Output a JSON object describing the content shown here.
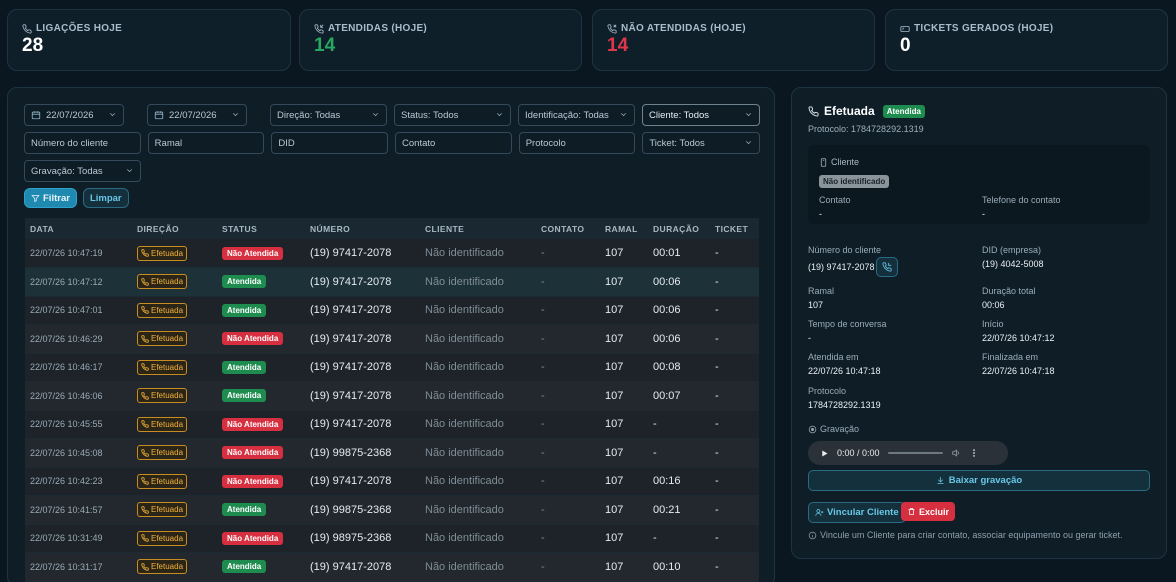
{
  "stats": [
    {
      "label": "LIGAÇÕES HOJE",
      "value": "28",
      "icon": "phone-icon"
    },
    {
      "label": "ATENDIDAS (HOJE)",
      "value": "14",
      "icon": "phone-incoming-icon"
    },
    {
      "label": "NÃO ATENDIDAS (HOJE)",
      "value": "14",
      "icon": "phone-missed-icon"
    },
    {
      "label": "TICKETS GERADOS (HOJE)",
      "value": "0",
      "icon": "ticket-icon"
    }
  ],
  "filters": {
    "date_from": "22/07/2026",
    "date_to": "22/07/2026",
    "direction": "Direção: Todas",
    "status": "Status: Todos",
    "identification": "Identificação: Todas",
    "client": "Cliente: Todos",
    "client_number_placeholder": "Número do cliente",
    "extension_placeholder": "Ramal",
    "did_placeholder": "DID",
    "contact_placeholder": "Contato",
    "protocol_placeholder": "Protocolo",
    "ticket": "Ticket: Todos",
    "recording": "Gravação: Todas",
    "filter_button": "Filtrar",
    "clear_button": "Limpar"
  },
  "table": {
    "headers": [
      "DATA",
      "DIREÇÃO",
      "STATUS",
      "NÚMERO",
      "CLIENTE",
      "CONTATO",
      "RAMAL",
      "DURAÇÃO",
      "TICKET"
    ],
    "rows": [
      {
        "date": "22/07/26 10:47:19",
        "direction": "Efetuada",
        "status": "Não Atendida",
        "status_type": "no",
        "number": "(19) 97417-2078",
        "client": "Não identificado",
        "contact": "-",
        "ext": "107",
        "duration": "00:01",
        "ticket": "-"
      },
      {
        "date": "22/07/26 10:47:12",
        "direction": "Efetuada",
        "status": "Atendida",
        "status_type": "ok",
        "number": "(19) 97417-2078",
        "client": "Não identificado",
        "contact": "-",
        "ext": "107",
        "duration": "00:06",
        "ticket": "-"
      },
      {
        "date": "22/07/26 10:47:01",
        "direction": "Efetuada",
        "status": "Atendida",
        "status_type": "ok",
        "number": "(19) 97417-2078",
        "client": "Não identificado",
        "contact": "-",
        "ext": "107",
        "duration": "00:06",
        "ticket": "-"
      },
      {
        "date": "22/07/26 10:46:29",
        "direction": "Efetuada",
        "status": "Não Atendida",
        "status_type": "no",
        "number": "(19) 97417-2078",
        "client": "Não identificado",
        "contact": "-",
        "ext": "107",
        "duration": "00:06",
        "ticket": "-"
      },
      {
        "date": "22/07/26 10:46:17",
        "direction": "Efetuada",
        "status": "Atendida",
        "status_type": "ok",
        "number": "(19) 97417-2078",
        "client": "Não identificado",
        "contact": "-",
        "ext": "107",
        "duration": "00:08",
        "ticket": "-"
      },
      {
        "date": "22/07/26 10:46:06",
        "direction": "Efetuada",
        "status": "Atendida",
        "status_type": "ok",
        "number": "(19) 97417-2078",
        "client": "Não identificado",
        "contact": "-",
        "ext": "107",
        "duration": "00:07",
        "ticket": "-"
      },
      {
        "date": "22/07/26 10:45:55",
        "direction": "Efetuada",
        "status": "Não Atendida",
        "status_type": "no",
        "number": "(19) 97417-2078",
        "client": "Não identificado",
        "contact": "-",
        "ext": "107",
        "duration": "-",
        "ticket": "-"
      },
      {
        "date": "22/07/26 10:45:08",
        "direction": "Efetuada",
        "status": "Não Atendida",
        "status_type": "no",
        "number": "(19) 99875-2368",
        "client": "Não identificado",
        "contact": "-",
        "ext": "107",
        "duration": "-",
        "ticket": "-"
      },
      {
        "date": "22/07/26 10:42:23",
        "direction": "Efetuada",
        "status": "Não Atendida",
        "status_type": "no",
        "number": "(19) 97417-2078",
        "client": "Não identificado",
        "contact": "-",
        "ext": "107",
        "duration": "00:16",
        "ticket": "-"
      },
      {
        "date": "22/07/26 10:41:57",
        "direction": "Efetuada",
        "status": "Atendida",
        "status_type": "ok",
        "number": "(19) 99875-2368",
        "client": "Não identificado",
        "contact": "-",
        "ext": "107",
        "duration": "00:21",
        "ticket": "-"
      },
      {
        "date": "22/07/26 10:31:49",
        "direction": "Efetuada",
        "status": "Não Atendida",
        "status_type": "no",
        "number": "(19) 98975-2368",
        "client": "Não identificado",
        "contact": "-",
        "ext": "107",
        "duration": "-",
        "ticket": "-"
      },
      {
        "date": "22/07/26 10:31:17",
        "direction": "Efetuada",
        "status": "Atendida",
        "status_type": "ok",
        "number": "(19) 97417-2078",
        "client": "Não identificado",
        "contact": "-",
        "ext": "107",
        "duration": "00:10",
        "ticket": "-"
      }
    ]
  },
  "detail": {
    "title": "Efetuada",
    "status_badge": "Atendida",
    "protocol_line": "Protocolo: 1784728292.1319",
    "client_section": "Cliente",
    "client_badge": "Não identificado",
    "contact_label": "Contato",
    "contact_value": "-",
    "contact_phone_label": "Telefone do contato",
    "contact_phone_value": "-",
    "client_number_label": "Número do cliente",
    "client_number_value": "(19) 97417-2078",
    "did_label": "DID (empresa)",
    "did_value": "(19) 4042-5008",
    "ext_label": "Ramal",
    "ext_value": "107",
    "total_duration_label": "Duração total",
    "total_duration_value": "00:06",
    "talk_time_label": "Tempo de conversa",
    "talk_time_value": "-",
    "start_label": "Início",
    "start_value": "22/07/26 10:47:12",
    "answered_label": "Atendida em",
    "answered_value": "22/07/26 10:47:18",
    "ended_label": "Finalizada em",
    "ended_value": "22/07/26 10:47:18",
    "protocol_label": "Protocolo",
    "protocol_value": "1784728292.1319",
    "recording_label": "Gravação",
    "audio_time": "0:00 / 0:00",
    "download_button": "Baixar gravação",
    "link_client_button": "Vincular Cliente",
    "delete_button": "Excluir",
    "hint": "Vincule um Cliente para criar contato, associar equipamento ou gerar ticket."
  }
}
